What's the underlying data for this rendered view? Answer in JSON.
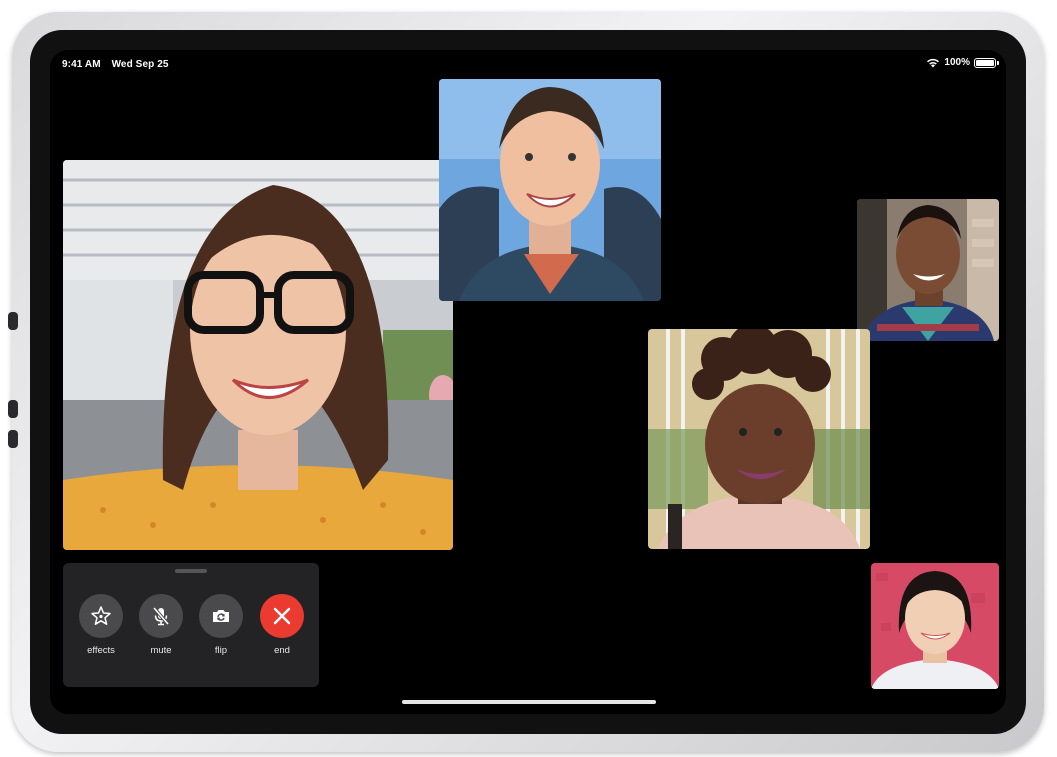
{
  "status_bar": {
    "time": "9:41 AM",
    "date": "Wed Sep 25",
    "battery": "100%"
  },
  "participants": [
    {
      "id": "woman-glasses",
      "shirt_color": "#e8a83c",
      "background": "#c9cdd2"
    },
    {
      "id": "man-backpack",
      "shirt_color": "#2e4a63",
      "background": "#6ea6e0"
    },
    {
      "id": "man-jacket",
      "shirt_color": "#a33b48",
      "background": "#8a7c6f"
    },
    {
      "id": "woman-curly",
      "shirt_color": "#e9c3b8",
      "background": "#d8c79a"
    },
    {
      "id": "woman-pink",
      "shirt_color": "#eef0f3",
      "background": "#d64a66"
    }
  ],
  "controls": {
    "effects": {
      "label": "effects",
      "icon": "star-effects-icon"
    },
    "mute": {
      "label": "mute",
      "icon": "mic-slash-icon"
    },
    "flip": {
      "label": "flip",
      "icon": "camera-flip-icon"
    },
    "end": {
      "label": "end",
      "icon": "close-x-icon",
      "color": "#eb3b30"
    }
  },
  "colors": {
    "screen": "#000000",
    "panel": "#232325",
    "button": "#4a4a4c",
    "end_button": "#eb3b30"
  }
}
